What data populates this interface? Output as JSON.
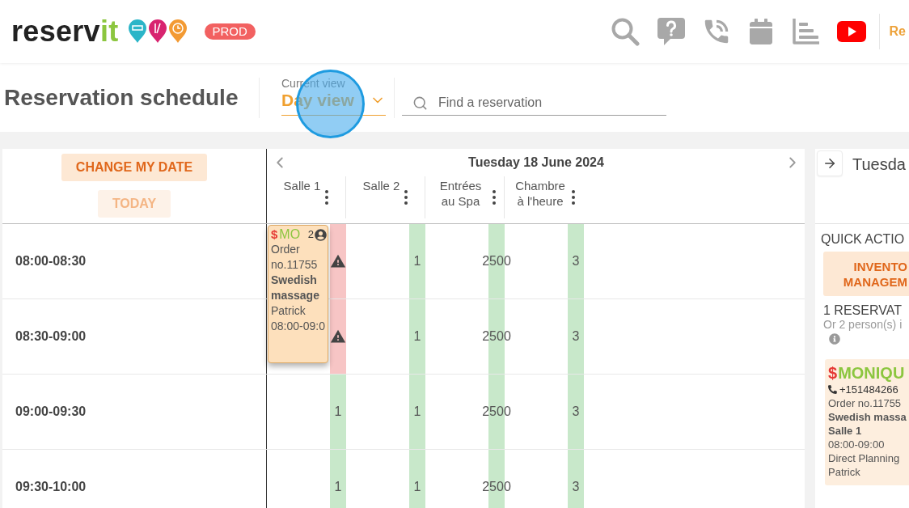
{
  "header": {
    "logo": {
      "dark": "reserv",
      "accent": "it"
    },
    "environment_badge": "PROD",
    "top_right_text": "Re"
  },
  "title_bar": {
    "title": "Reservation schedule",
    "view_selector": {
      "label": "Current view",
      "value": "Day view"
    },
    "search": {
      "placeholder": "Find a reservation"
    }
  },
  "schedule": {
    "buttons": [
      {
        "label": "CHANGE MY DATE",
        "disabled": false
      },
      {
        "label": "TODAY",
        "disabled": true
      }
    ],
    "date": "Tuesday 18 June 2024",
    "columns": [
      {
        "name": "Salle 1"
      },
      {
        "name": "Salle 2"
      },
      {
        "name": "Entrées au Spa"
      },
      {
        "name": "Chambre à l'heure"
      }
    ],
    "rows": [
      {
        "time": "08:00-08:30",
        "cells": [
          {
            "kind": "warning",
            "reservation": {
              "paid": "$",
              "client": "MO",
              "persons": "2",
              "order": "Order no.11755",
              "service": "Swedish massage",
              "staff": "Patrick",
              "time": "08:00-09:0"
            }
          },
          {
            "kind": "available",
            "count": "1"
          },
          {
            "kind": "available",
            "count": "2500"
          },
          {
            "kind": "available",
            "count": "3"
          }
        ]
      },
      {
        "time": "08:30-09:00",
        "cells": [
          {
            "kind": "warning"
          },
          {
            "kind": "available",
            "count": "1"
          },
          {
            "kind": "available",
            "count": "2500"
          },
          {
            "kind": "available",
            "count": "3"
          }
        ]
      },
      {
        "time": "09:00-09:30",
        "cells": [
          {
            "kind": "available",
            "count": "1"
          },
          {
            "kind": "available",
            "count": "1"
          },
          {
            "kind": "available",
            "count": "2500"
          },
          {
            "kind": "available",
            "count": "3"
          }
        ]
      },
      {
        "time": "09:30-10:00",
        "cells": [
          {
            "kind": "available",
            "count": "1"
          },
          {
            "kind": "available",
            "count": "1"
          },
          {
            "kind": "available",
            "count": "2500"
          },
          {
            "kind": "available",
            "count": "3"
          }
        ]
      }
    ]
  },
  "side_panel": {
    "day_title": "Tuesda",
    "quick_actions": {
      "title": "QUICK ACTIO",
      "button": "INVENTO MANAGEM"
    },
    "reservation_count": "1 RESERVAT",
    "persons_note": "Or 2 person(s) i",
    "reservation": {
      "paid": "$",
      "client": "MONIQU",
      "phone": "+151484266",
      "order": "Order no.11755",
      "service": "Swedish massa",
      "room": "Salle 1",
      "time": "08:00-09:00",
      "source": "Direct Planning",
      "staff": "Patrick"
    }
  }
}
